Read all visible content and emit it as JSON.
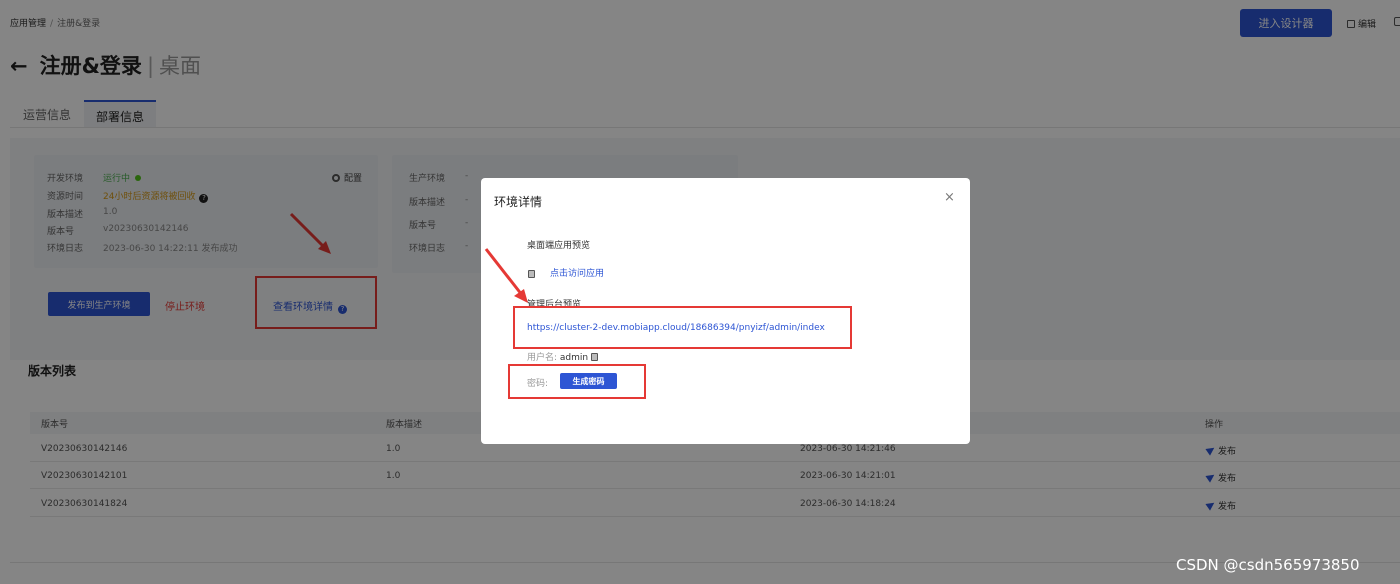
{
  "breadcrumb": {
    "root": "应用管理",
    "sep": "/",
    "current": "注册&登录"
  },
  "header": {
    "design_button": "进入设计器",
    "edit_label": "编辑"
  },
  "page": {
    "back_arrow": "←",
    "title": "注册&登录",
    "pipe": "|",
    "subtitle": "桌面"
  },
  "tabs": [
    {
      "label": "运营信息"
    },
    {
      "label": "部署信息"
    }
  ],
  "dev_env": {
    "rows": [
      {
        "key": "开发环境",
        "value": "运行中"
      },
      {
        "key": "资源时间",
        "value": "24小时后资源将被回收"
      },
      {
        "key": "版本描述",
        "value": "1.0"
      },
      {
        "key": "版本号",
        "value": "v20230630142146"
      },
      {
        "key": "环境日志",
        "value": "2023-06-30 14:22:11 发布成功"
      }
    ],
    "config_label": "配置",
    "publish_button": "发布到生产环境",
    "stop_link": "停止环境",
    "view_link": "查看环境详情",
    "help_glyph": "?"
  },
  "prod_env": {
    "rows": [
      {
        "key": "生产环境",
        "value": "-"
      },
      {
        "key": "版本描述",
        "value": "-"
      },
      {
        "key": "版本号",
        "value": "-"
      },
      {
        "key": "环境日志",
        "value": "-"
      }
    ]
  },
  "versions": {
    "title": "版本列表",
    "columns": [
      "版本号",
      "版本描述",
      "操作"
    ],
    "rows": [
      {
        "id": "V20230630142146",
        "desc": "1.0",
        "time": "2023-06-30 14:21:46",
        "action": "发布"
      },
      {
        "id": "V20230630142101",
        "desc": "1.0",
        "time": "2023-06-30 14:21:01",
        "action": "发布"
      },
      {
        "id": "V20230630141824",
        "desc": "",
        "time": "2023-06-30 14:18:24",
        "action": "发布"
      }
    ]
  },
  "modal": {
    "title": "环境详情",
    "close": "×",
    "desktop_label": "桌面端应用预览",
    "visit_link": "点击访问应用",
    "admin_label": "管理后台预览",
    "admin_url": "https://cluster-2-dev.mobiapp.cloud/18686394/pnyizf/admin/index",
    "username_label": "用户名:",
    "username_value": "admin",
    "password_label": "密码:",
    "generate_button": "生成密码"
  },
  "watermark": "CSDN @csdn565973850",
  "colors": {
    "primary": "#2d55d4",
    "danger": "#e53935",
    "success": "#52c41a",
    "warning": "#d59a17"
  }
}
